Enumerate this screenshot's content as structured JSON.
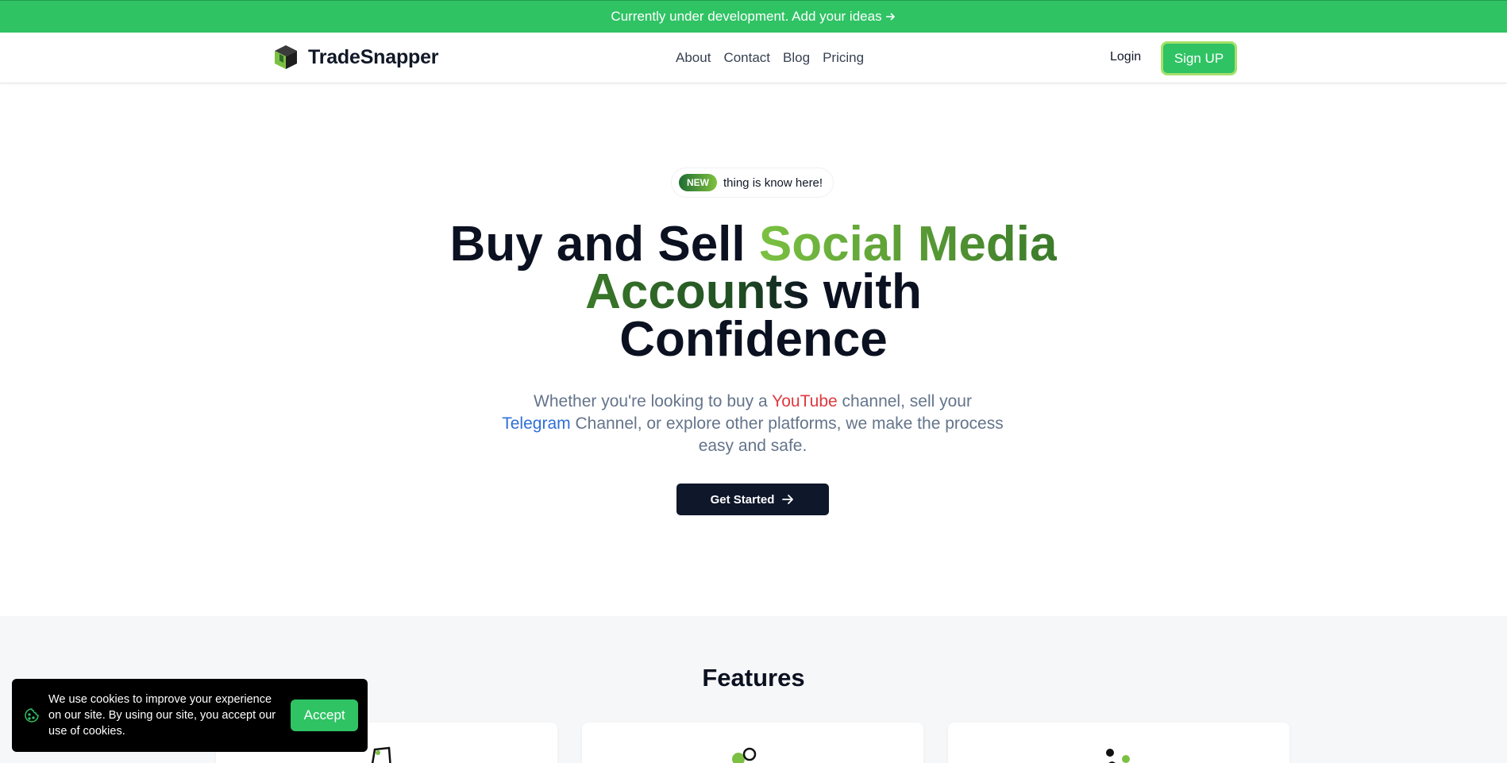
{
  "announcement": {
    "text": "Currently under development. Add your ideas"
  },
  "brand": {
    "name": "TradeSnapper"
  },
  "nav": {
    "links": [
      "About",
      "Contact",
      "Blog",
      "Pricing"
    ],
    "login": "Login",
    "signup": "Sign UP"
  },
  "hero": {
    "badge_pill": "NEW",
    "badge_text": "thing is know here!",
    "headline": {
      "part1": "Buy and Sell ",
      "highlight1": "Social Media",
      "highlight2": "Accounts",
      "part2": " with",
      "part3": "Confidence"
    },
    "subtitle": {
      "s1": "Whether you're looking to buy a ",
      "youtube": "YouTube",
      "s2": " channel, sell your ",
      "telegram": "Telegram",
      "s3": " Channel, or explore other platforms, we make the process easy and safe."
    },
    "cta": "Get Started"
  },
  "features": {
    "title": "Features"
  },
  "cookie": {
    "text": "We use cookies to improve your experience on our site. By using our site, you accept our use of cookies.",
    "accept": "Accept"
  },
  "colors": {
    "accent": "#2fc364",
    "dark": "#0f172a",
    "youtube": "#e0383e",
    "telegram": "#2f6fd6"
  },
  "icons": {
    "announce_arrow": "arrow-right-icon",
    "cta_arrow": "arrow-right-icon",
    "logo": "cube-logo-icon",
    "cookie": "cookie-icon"
  }
}
